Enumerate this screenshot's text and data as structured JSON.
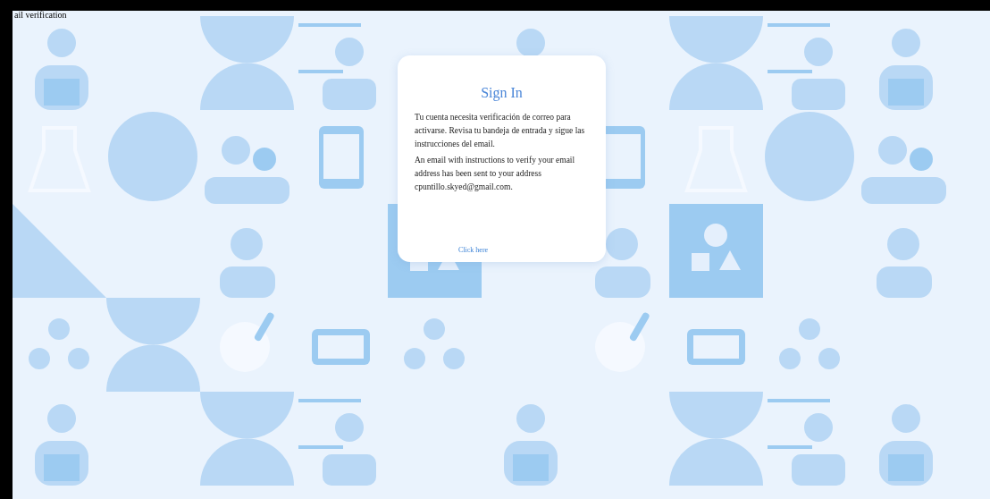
{
  "page": {
    "title": "ail verification"
  },
  "card": {
    "title": "Sign In",
    "paragraphs": [
      "Tu cuenta necesita verificación de correo para activarse. Revisa tu bandeja de entrada y sigue las instrucciones del email.",
      "An email with instructions to verify your email address has been sent to your address cpuntillo.skyed@gmail.com."
    ],
    "link": "Click here"
  }
}
